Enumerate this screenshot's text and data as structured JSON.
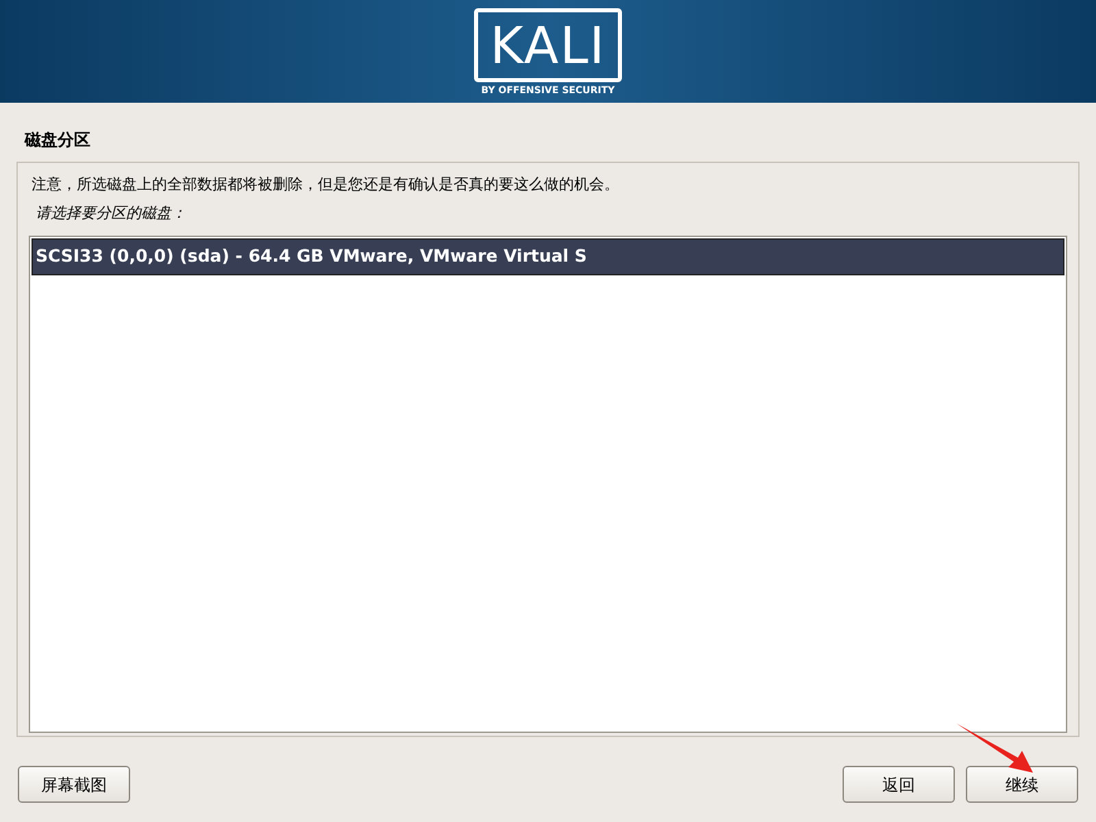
{
  "header": {
    "logo": "KALI",
    "tagline": "BY OFFENSIVE SECURITY"
  },
  "page_title": "磁盘分区",
  "notice": "注意，所选磁盘上的全部数据都将被删除，但是您还是有确认是否真的要这么做的机会。",
  "prompt": "请选择要分区的磁盘：",
  "disks": [
    {
      "label": "SCSI33 (0,0,0) (sda) - 64.4 GB VMware, VMware Virtual S",
      "selected": true
    }
  ],
  "buttons": {
    "left": [
      "屏幕截图"
    ],
    "right": [
      "返回",
      "继续"
    ]
  }
}
